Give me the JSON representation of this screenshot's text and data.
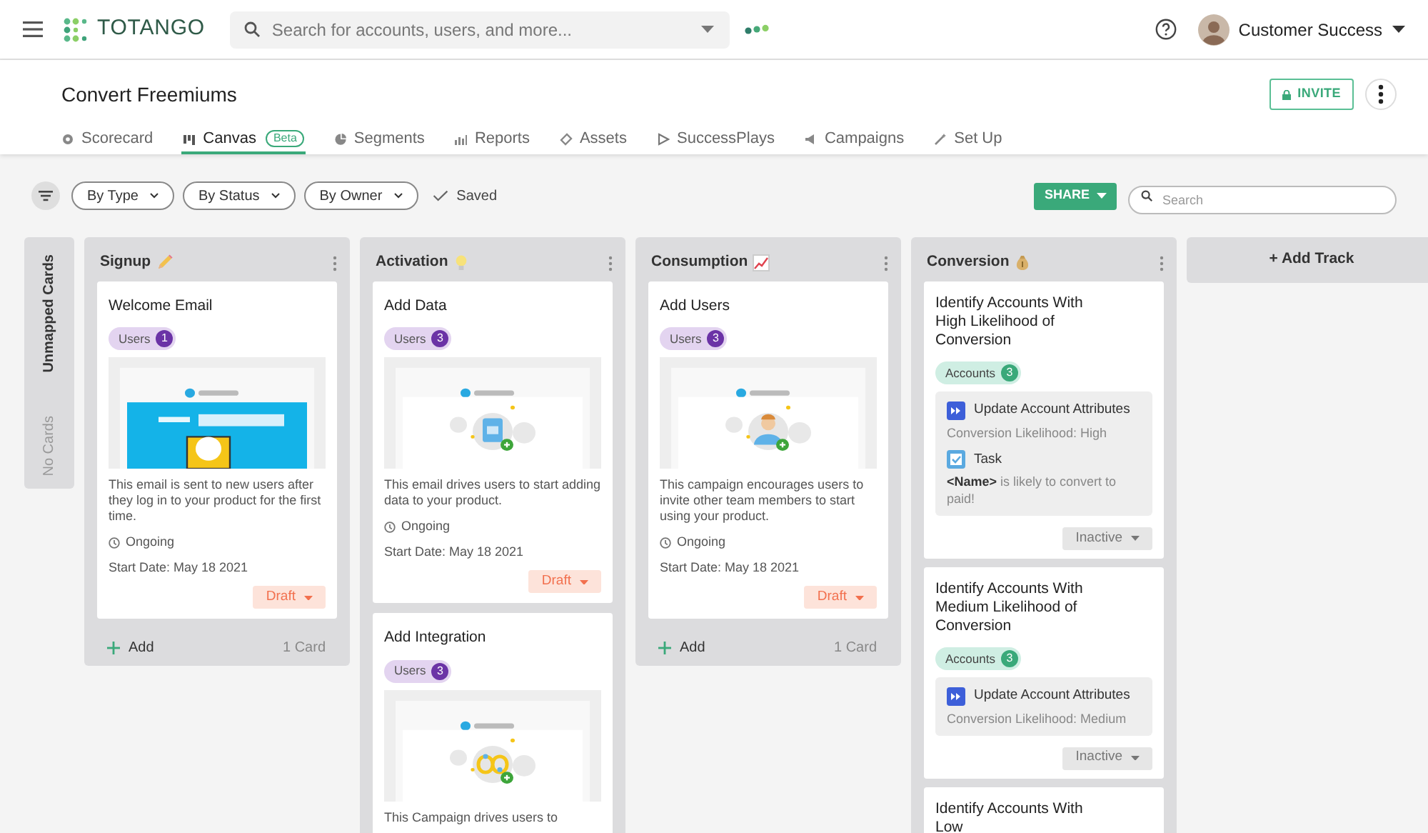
{
  "topbar": {
    "logo": "TOTANGO",
    "search": {
      "placeholder": "Search for accounts, users, and more..."
    },
    "user": "Customer Success"
  },
  "header": {
    "title": "Convert Freemiums",
    "invite": "INVITE"
  },
  "tabs": [
    {
      "label": "Scorecard",
      "selected": false
    },
    {
      "label": "Canvas",
      "badge": "Beta",
      "selected": true
    },
    {
      "label": "Segments",
      "selected": false
    },
    {
      "label": "Reports",
      "selected": false
    },
    {
      "label": "Assets",
      "selected": false
    },
    {
      "label": "SuccessPlays",
      "selected": false
    },
    {
      "label": "Campaigns",
      "selected": false
    },
    {
      "label": "Set Up",
      "selected": false
    }
  ],
  "toolbar": {
    "filters": [
      "By Type",
      "By Status",
      "By Owner"
    ],
    "saved": "Saved",
    "share": "SHARE",
    "search": {
      "placeholder": "Search"
    }
  },
  "unmapped": {
    "title": "Unmapped Cards",
    "empty": "No Cards"
  },
  "columns": [
    {
      "title": "Signup",
      "cards": [
        {
          "kind": "campaign",
          "title": "Welcome Email",
          "tag": {
            "kind": "users",
            "label": "Users",
            "count": "1"
          },
          "description": "This email is sent to new users after they log in to your product for the first time.",
          "schedule": "Ongoing",
          "date": "Start Date: May 18 2021",
          "status": "Draft"
        }
      ],
      "footer": {
        "add": "Add",
        "count": "1 Card"
      }
    },
    {
      "title": "Activation",
      "cards": [
        {
          "kind": "campaign",
          "title": "Add Data",
          "tag": {
            "kind": "users",
            "label": "Users",
            "count": "3"
          },
          "description": "This email drives users to start adding data to your product.",
          "schedule": "Ongoing",
          "date": "Start Date: May 18 2021",
          "status": "Draft"
        },
        {
          "kind": "campaign",
          "title": "Add Integration",
          "tag": {
            "kind": "users",
            "label": "Users",
            "count": "3"
          },
          "description": "This Campaign drives users to"
        }
      ]
    },
    {
      "title": "Consumption",
      "cards": [
        {
          "kind": "campaign",
          "title": "Add Users",
          "tag": {
            "kind": "users",
            "label": "Users",
            "count": "3"
          },
          "description": "This campaign encourages users to invite other team members to start using your product.",
          "schedule": "Ongoing",
          "date": "Start Date: May 18 2021",
          "status": "Draft"
        }
      ],
      "footer": {
        "add": "Add",
        "count": "1 Card"
      }
    },
    {
      "title": "Conversion",
      "cards": [
        {
          "kind": "play",
          "title": "Identify Accounts With High Likelihood of Conversion",
          "tag": {
            "kind": "accounts",
            "label": "Accounts",
            "count": "3"
          },
          "actions": [
            {
              "kind": "update",
              "title": "Update Account Attributes",
              "detail": "Conversion Likelihood: High"
            },
            {
              "kind": "task",
              "title": "Task",
              "detail": "**<Name>** is likely to convert to paid!"
            }
          ],
          "status": "Inactive"
        },
        {
          "kind": "play",
          "title": "Identify Accounts With Medium Likelihood of Conversion",
          "tag": {
            "kind": "accounts",
            "label": "Accounts",
            "count": "3"
          },
          "actions": [
            {
              "kind": "update",
              "title": "Update Account Attributes",
              "detail": "Conversion Likelihood: Medium"
            }
          ],
          "status": "Inactive"
        },
        {
          "kind": "play",
          "title": "Identify Accounts With Low"
        }
      ]
    }
  ],
  "add_track": "+ Add Track"
}
